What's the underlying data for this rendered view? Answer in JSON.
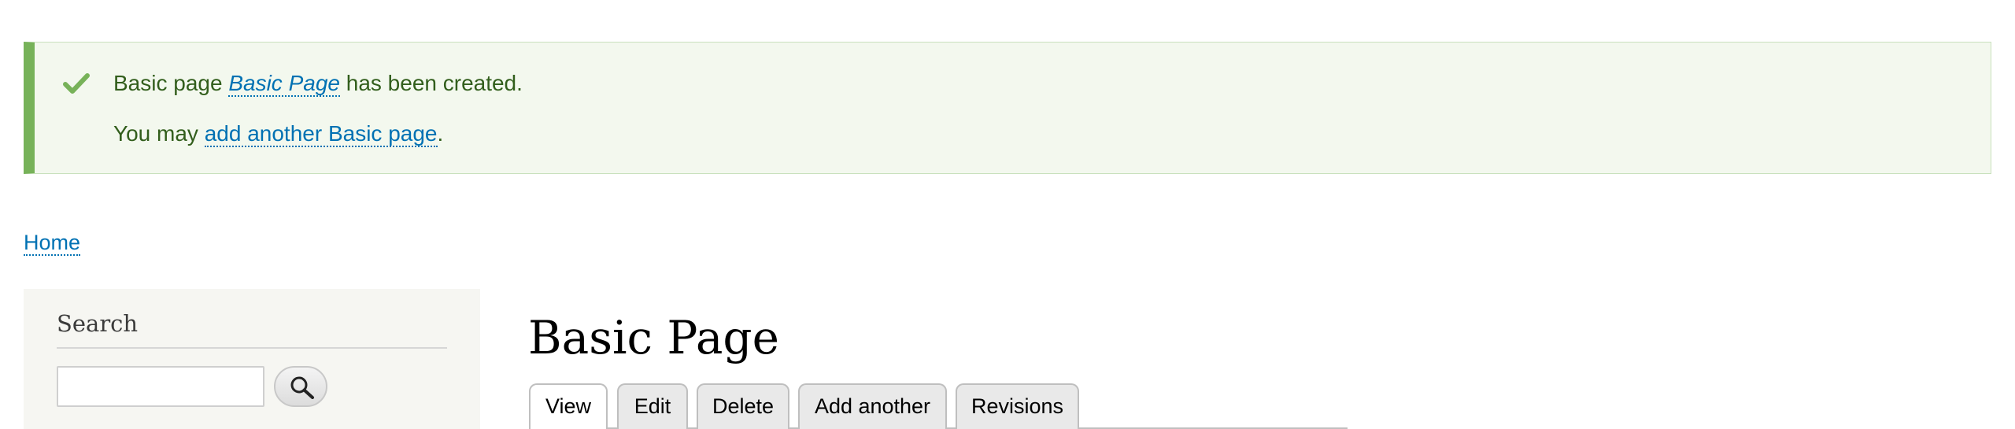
{
  "status": {
    "line1": {
      "prefix": "Basic page ",
      "link": "Basic Page",
      "suffix": " has been created."
    },
    "line2": {
      "prefix": "You may ",
      "link": "add another Basic page",
      "suffix": "."
    }
  },
  "breadcrumb": {
    "home": "Home"
  },
  "sidebar": {
    "search_title": "Search"
  },
  "main": {
    "title": "Basic Page",
    "tabs": [
      {
        "label": "View",
        "active": true
      },
      {
        "label": "Edit",
        "active": false
      },
      {
        "label": "Delete",
        "active": false
      },
      {
        "label": "Add another",
        "active": false
      },
      {
        "label": "Revisions",
        "active": false
      }
    ]
  },
  "colors": {
    "status_bg": "#f3f8ee",
    "status_accent": "#77b259",
    "status_text": "#325e1c",
    "link": "#0071b3",
    "sidebar_bg": "#f6f6f2"
  },
  "icons": {
    "status": "check-icon",
    "search": "search-icon"
  }
}
